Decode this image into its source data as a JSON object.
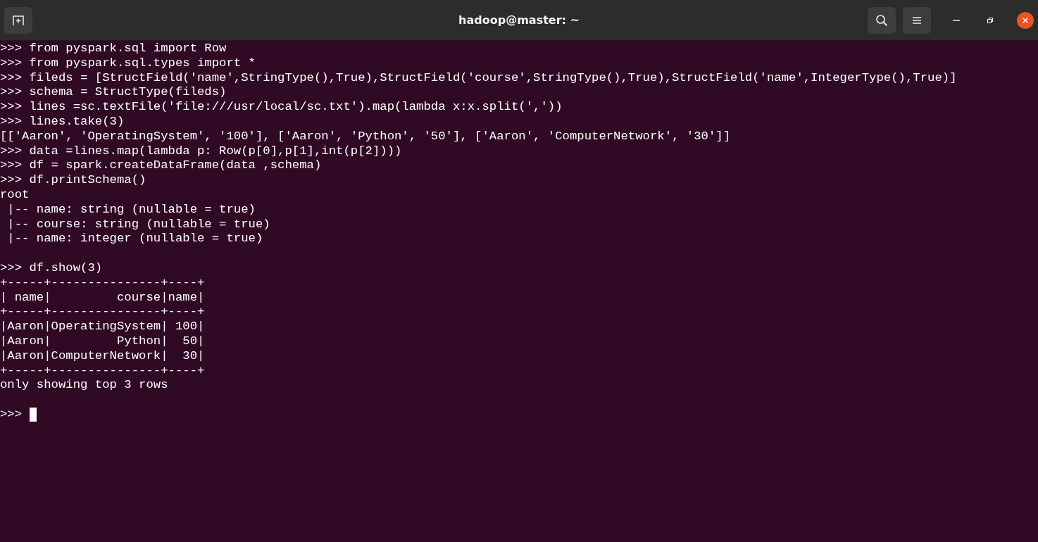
{
  "window": {
    "title": "hadoop@master: ~"
  },
  "terminal": {
    "lines": [
      {
        "text": ">>> from pyspark.sql import Row"
      },
      {
        "text": ">>> from pyspark.sql.types import *"
      },
      {
        "text": ">>> fileds = [StructField('name',StringType(),True),StructField('course',StringType(),True),StructField('name',IntegerType(),True)]"
      },
      {
        "text": ">>> schema = StructType(fileds)"
      },
      {
        "text": ">>> lines =sc.textFile('file:///usr/local/sc.txt').map(lambda x:x.split(','))"
      },
      {
        "text": ">>> lines.take(3)"
      },
      {
        "text": "[['Aaron', 'OperatingSystem', '100'], ['Aaron', 'Python', '50'], ['Aaron', 'ComputerNetwork', '30']]"
      },
      {
        "text": ">>> data =lines.map(lambda p: Row(p[0],p[1],int(p[2])))"
      },
      {
        "text": ">>> df = spark.createDataFrame(data ,schema)"
      },
      {
        "text": ">>> df.printSchema()"
      },
      {
        "text": "root"
      },
      {
        "text": " |-- name: string (nullable = true)"
      },
      {
        "text": " |-- course: string (nullable = true)"
      },
      {
        "text": " |-- name: integer (nullable = true)"
      },
      {
        "text": ">>> df.show(3)",
        "blank_before": true
      },
      {
        "text": "+-----+---------------+----+"
      },
      {
        "text": "| name|         course|name|"
      },
      {
        "text": "+-----+---------------+----+"
      },
      {
        "text": "|Aaron|OperatingSystem| 100|"
      },
      {
        "text": "|Aaron|         Python|  50|"
      },
      {
        "text": "|Aaron|ComputerNetwork|  30|"
      },
      {
        "text": "+-----+---------------+----+"
      },
      {
        "text": "only showing top 3 rows"
      },
      {
        "text": ">>>",
        "blank_before": true,
        "cursor": true
      }
    ]
  }
}
